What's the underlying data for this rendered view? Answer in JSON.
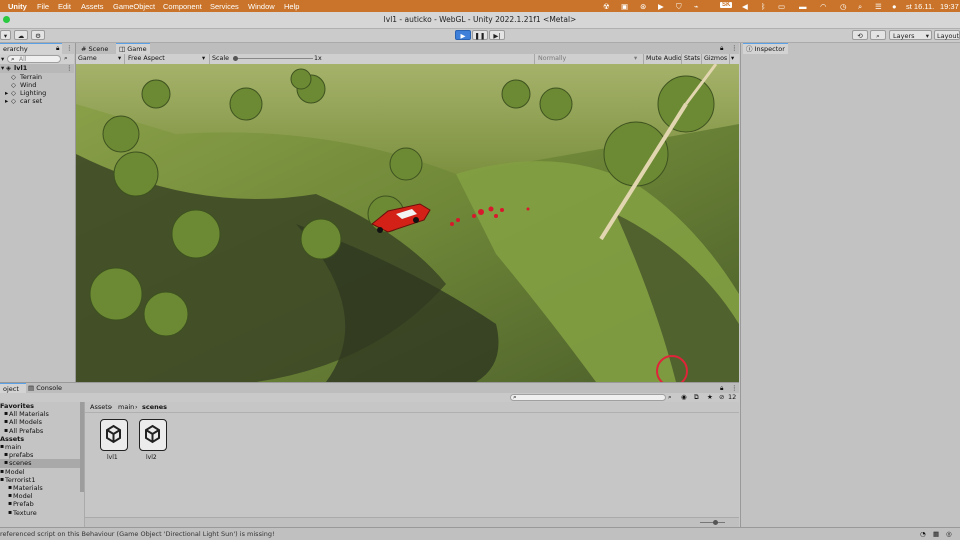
{
  "menubar": {
    "items": [
      "Unity",
      "File",
      "Edit",
      "Assets",
      "GameObject",
      "Component",
      "Services",
      "Window",
      "Help"
    ],
    "keyboard": "SK",
    "date": "st 16.11.",
    "time": "19:37"
  },
  "window": {
    "title": "lvl1 - auticko - WebGL - Unity 2022.1.21f1 <Metal>"
  },
  "toolbar": {
    "layers_label": "Layers",
    "layout_label": "Layout"
  },
  "hierarchy": {
    "tab_label": "erarchy",
    "search_placeholder": "All",
    "scene_name": "lvl1",
    "items": [
      "Terrain",
      "Wind",
      "Lighting",
      "car set"
    ]
  },
  "center_tabs": {
    "scene": "Scene",
    "game": "Game"
  },
  "gamebar": {
    "display": "Game",
    "aspect": "Free Aspect",
    "scale_label": "Scale",
    "scale_value": "1x",
    "quality": "Normally",
    "mute_audio": "Mute Audio",
    "stats": "Stats",
    "gizmos": "Gizmos"
  },
  "inspector": {
    "tab_label": "Inspector"
  },
  "bottom_tabs": {
    "project": "oject",
    "console": "Console"
  },
  "project": {
    "breadcrumb": [
      "Assets",
      "main",
      "scenes"
    ],
    "hidden_count": "12",
    "tree": [
      {
        "label": "Favorites",
        "bold": true,
        "indent": 0
      },
      {
        "label": "All Materials",
        "indent": 1
      },
      {
        "label": "All Models",
        "indent": 1
      },
      {
        "label": "All Prefabs",
        "indent": 1
      },
      {
        "label": "Assets",
        "bold": true,
        "indent": 0
      },
      {
        "label": "main",
        "indent": 0
      },
      {
        "label": "prefabs",
        "indent": 1
      },
      {
        "label": "scenes",
        "indent": 1,
        "selected": true
      },
      {
        "label": "Model",
        "indent": 0
      },
      {
        "label": "Terrorist1",
        "indent": 0
      },
      {
        "label": "Materials",
        "indent": 2
      },
      {
        "label": "Model",
        "indent": 2
      },
      {
        "label": "Prefab",
        "indent": 2
      },
      {
        "label": "Texture",
        "indent": 2
      }
    ],
    "assets": [
      {
        "name": "lvl1",
        "icon": "unity-scene-icon"
      },
      {
        "name": "lvl2",
        "icon": "unity-scene-icon"
      }
    ]
  },
  "status": {
    "message": "referenced script on this Behaviour (Game Object 'Directional Light Sun') is missing!"
  },
  "colors": {
    "menubar": "#c9742a",
    "play_button": "#3d7fd9",
    "selection": "#5aa0e6"
  }
}
